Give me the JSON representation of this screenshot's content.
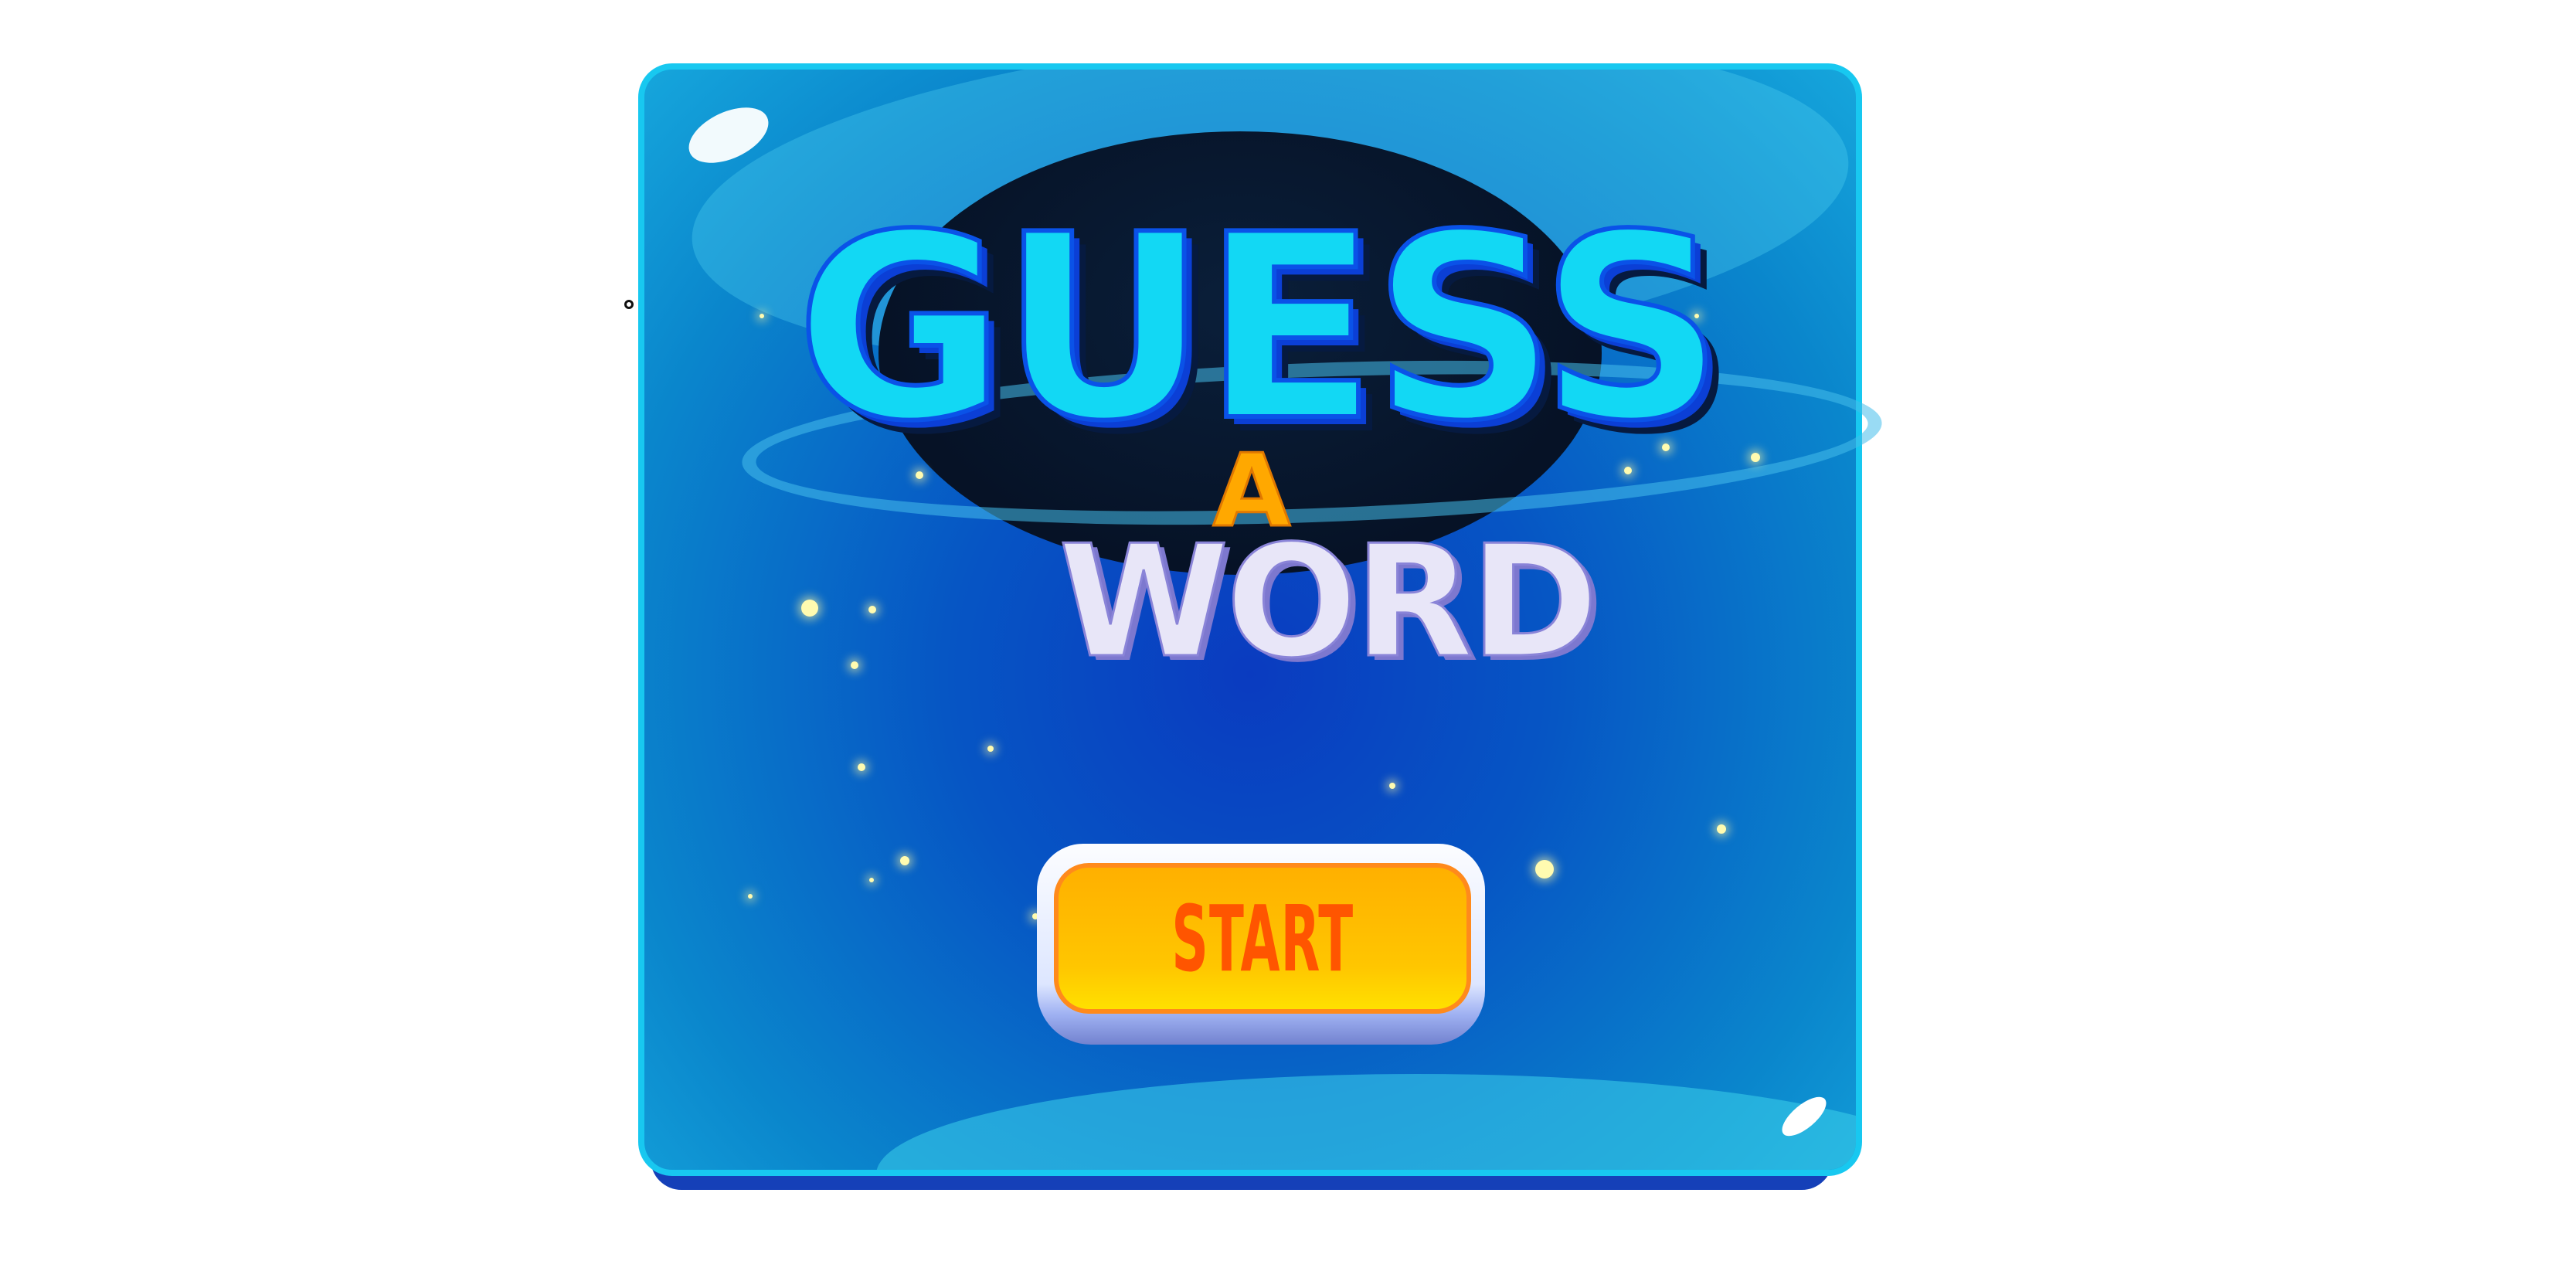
{
  "title": {
    "line1": "GUESS",
    "line2": "A",
    "line3": "WORD"
  },
  "start_button": {
    "label": "START"
  },
  "colors": {
    "panel": "#0655c4",
    "panel_border": "#18c8f0",
    "title_guess": "#12d8f4",
    "title_a": "#ffa800",
    "title_word": "#e8e6f8",
    "button_face": "#ffc600",
    "button_text": "#ff5500"
  }
}
